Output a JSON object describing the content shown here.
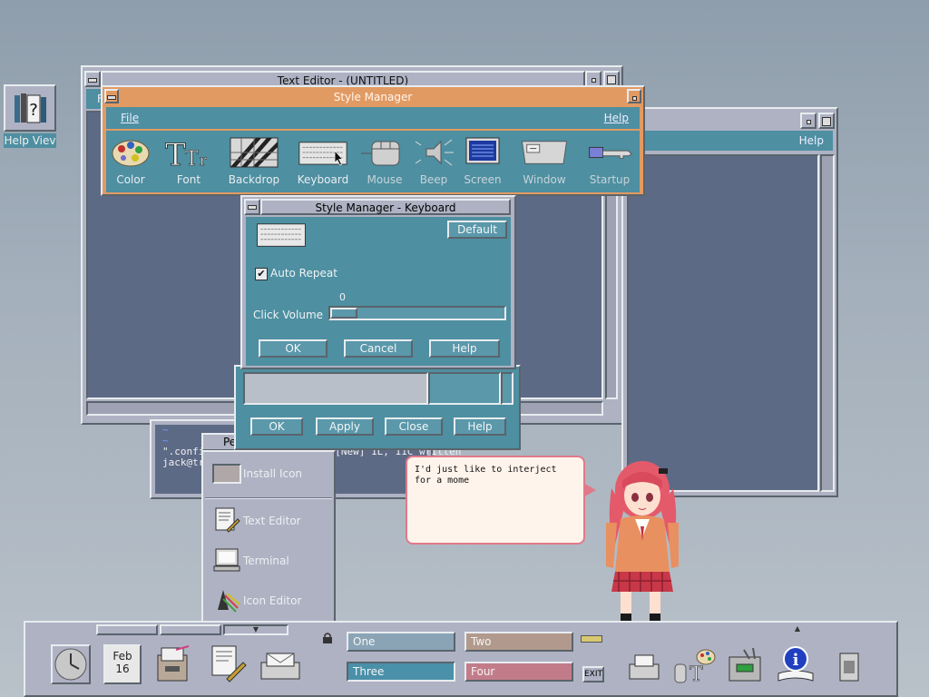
{
  "help_viewer": {
    "label": "Help Viev"
  },
  "text_editor": {
    "title": "Text Editor - (UNTITLED)",
    "menu_stub": "F"
  },
  "back_window": {
    "help_label": "Help"
  },
  "style_manager": {
    "title": "Style Manager",
    "menu_file": "File",
    "menu_help": "Help",
    "tools": [
      {
        "label": "Color",
        "icon": "palette-icon"
      },
      {
        "label": "Font",
        "icon": "font-icon"
      },
      {
        "label": "Backdrop",
        "icon": "backdrop-icon"
      },
      {
        "label": "Keyboard",
        "icon": "keyboard-icon"
      },
      {
        "label": "Mouse",
        "icon": "mouse-icon"
      },
      {
        "label": "Beep",
        "icon": "speaker-icon"
      },
      {
        "label": "Screen",
        "icon": "monitor-icon"
      },
      {
        "label": "Window",
        "icon": "window-icon"
      },
      {
        "label": "Startup",
        "icon": "key-icon"
      }
    ]
  },
  "keyboard_dialog": {
    "title": "Style Manager - Keyboard",
    "default_label": "Default",
    "auto_repeat_label": "Auto Repeat",
    "auto_repeat_checked": true,
    "click_volume_label": "Click Volume",
    "click_volume_value": "0",
    "ok_label": "OK",
    "cancel_label": "Cancel",
    "help_label": "Help"
  },
  "lower_dialog": {
    "ok_label": "OK",
    "apply_label": "Apply",
    "close_label": "Close",
    "help_label": "Help"
  },
  "terminal": {
    "title_stub": "Pe",
    "tilde_lines": [
      "~",
      "~"
    ],
    "line_config": "\".confi",
    "line_status": "\" [New] 1L, 11C written",
    "line_prompt": "jack@tr"
  },
  "popup_menu": {
    "items": [
      {
        "label": "Install Icon",
        "icon": "install-icon"
      },
      {
        "label": "Text Editor",
        "icon": "text-editor-icon"
      },
      {
        "label": "Terminal",
        "icon": "terminal-icon"
      },
      {
        "label": "Icon Editor",
        "icon": "icon-editor-icon"
      }
    ]
  },
  "speech_bubble": {
    "text": "I'd just like to interject for a mome"
  },
  "front_panel": {
    "date_month": "Feb",
    "date_day": "16",
    "workspaces": [
      "One",
      "Two",
      "Three",
      "Four"
    ],
    "exit_label": "EXIT",
    "workspace_colors": {
      "One": "#8aa4b6",
      "Two": "#b19a8d",
      "Three": "#4a90a8",
      "Four": "#c27c89"
    }
  }
}
